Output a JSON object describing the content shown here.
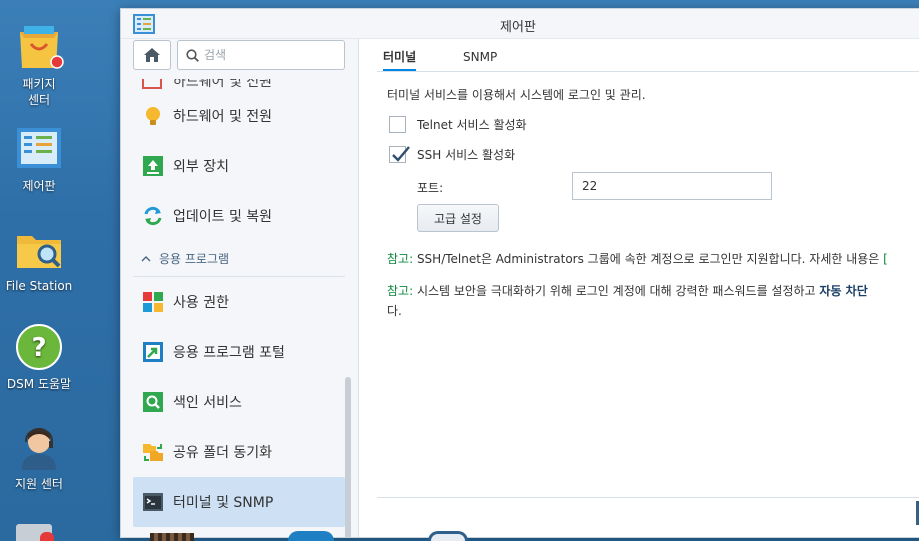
{
  "desktop": {
    "icons": [
      {
        "name": "package-center",
        "label_line1": "패키지",
        "label_line2": "센터"
      },
      {
        "name": "control-panel",
        "label_line1": "제어판",
        "label_line2": ""
      },
      {
        "name": "file-station",
        "label_line1": "File Station",
        "label_line2": ""
      },
      {
        "name": "dsm-help",
        "label_line1": "DSM 도움말",
        "label_line2": ""
      },
      {
        "name": "support-center",
        "label_line1": "지원 센터",
        "label_line2": ""
      }
    ]
  },
  "window": {
    "title": "제어판",
    "icon": "control-panel-icon"
  },
  "sidebar": {
    "search_placeholder": "검색",
    "partial_item": "하드웨어 및 전원",
    "items": [
      {
        "label": "하드웨어 및 전원",
        "icon": "bulb-icon"
      },
      {
        "label": "외부 장치",
        "icon": "external-device-icon"
      },
      {
        "label": "업데이트 및 복원",
        "icon": "update-restore-icon"
      }
    ],
    "section": "응용 프로그램",
    "app_items": [
      {
        "label": "사용 권한",
        "icon": "permissions-icon"
      },
      {
        "label": "응용 프로그램 포털",
        "icon": "app-portal-icon"
      },
      {
        "label": "색인 서비스",
        "icon": "index-service-icon"
      },
      {
        "label": "공유 폴더 동기화",
        "icon": "shared-folder-sync-icon"
      },
      {
        "label": "터미널 및 SNMP",
        "icon": "terminal-icon"
      }
    ]
  },
  "main": {
    "tabs": [
      {
        "label": "터미널"
      },
      {
        "label": "SNMP"
      }
    ],
    "description": "터미널 서비스를 이용해서 시스템에 로그인 및 관리.",
    "telnet_label": "Telnet 서비스 활성화",
    "telnet_checked": false,
    "ssh_label": "SSH 서비스 활성화",
    "ssh_checked": true,
    "port_label": "포트:",
    "port_value": "22",
    "advanced_button": "고급 설정",
    "note1_prefix": "참고:",
    "note1_text": " SSH/Telnet은 Administrators 그룹에 속한 계정으로 로그인만 지원합니다. 자세한 내용은 ",
    "note1_link": "[",
    "note2_prefix": "참고:",
    "note2_text": " 시스템 보안을 극대화하기 위해 로그인 계정에 대해 강력한 패스워드를 설정하고 ",
    "note2_bold": "자동 차단",
    "note2_line2": "다."
  },
  "colors": {
    "accent": "#0086e5",
    "note_green": "#0a8a3e",
    "active_bg": "#cde0f4"
  }
}
